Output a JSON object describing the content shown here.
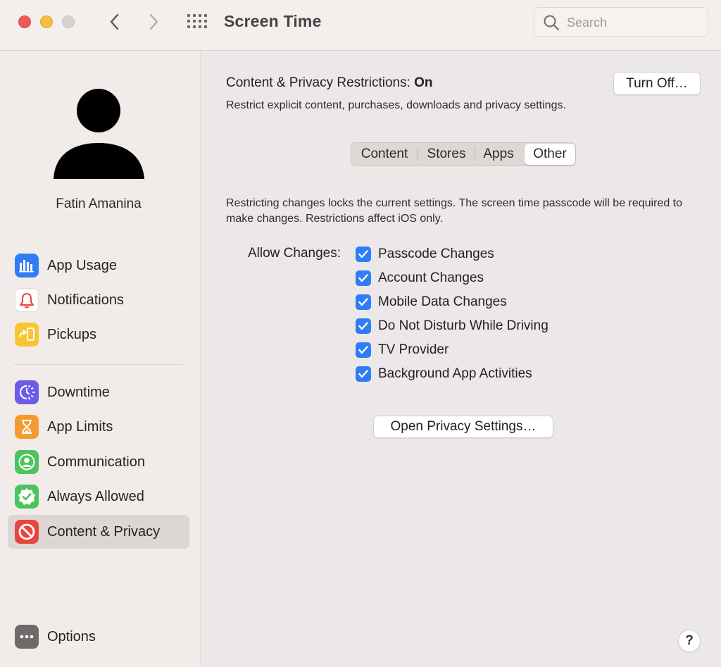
{
  "window": {
    "title": "Screen Time",
    "search_placeholder": "Search"
  },
  "user": {
    "name": "Fatin Amanina"
  },
  "sidebar": {
    "group1": [
      {
        "label": "App Usage",
        "icon": "bar-chart-icon",
        "color": "#2f7cf6"
      },
      {
        "label": "Notifications",
        "icon": "bell-icon",
        "color": "#ffffff"
      },
      {
        "label": "Pickups",
        "icon": "pickup-phone-icon",
        "color": "#f7c531"
      }
    ],
    "group2": [
      {
        "label": "Downtime",
        "icon": "downtime-icon",
        "color": "#6c5ce7"
      },
      {
        "label": "App Limits",
        "icon": "hourglass-icon",
        "color": "#f29b2e"
      },
      {
        "label": "Communication",
        "icon": "contact-icon",
        "color": "#4cc35c"
      },
      {
        "label": "Always Allowed",
        "icon": "checkmark-badge-icon",
        "color": "#4cc35c"
      },
      {
        "label": "Content & Privacy",
        "icon": "prohibited-icon",
        "color": "#e8453c",
        "selected": true
      }
    ],
    "options": {
      "label": "Options",
      "icon": "more-dots-icon",
      "color": "#6d6a69"
    }
  },
  "main": {
    "restrictions_label": "Content & Privacy Restrictions:",
    "restrictions_state": "On",
    "restrictions_desc": "Restrict explicit content, purchases, downloads and privacy settings.",
    "turn_off_button": "Turn Off…",
    "tabs": [
      {
        "label": "Content"
      },
      {
        "label": "Stores"
      },
      {
        "label": "Apps"
      },
      {
        "label": "Other",
        "active": true
      }
    ],
    "explain": "Restricting changes locks the current settings. The screen time passcode will be required to make changes. Restrictions affect iOS only.",
    "allow_label": "Allow Changes:",
    "options": [
      {
        "label": "Passcode Changes",
        "checked": true
      },
      {
        "label": "Account Changes",
        "checked": true
      },
      {
        "label": "Mobile Data Changes",
        "checked": true
      },
      {
        "label": "Do Not Disturb While Driving",
        "checked": true
      },
      {
        "label": "TV Provider",
        "checked": true
      },
      {
        "label": "Background App Activities",
        "checked": true
      }
    ],
    "privacy_button": "Open Privacy Settings…",
    "help_button": "?"
  },
  "colors": {
    "accent": "#2f7cf6",
    "selected_bg": "#dcd7d5"
  }
}
